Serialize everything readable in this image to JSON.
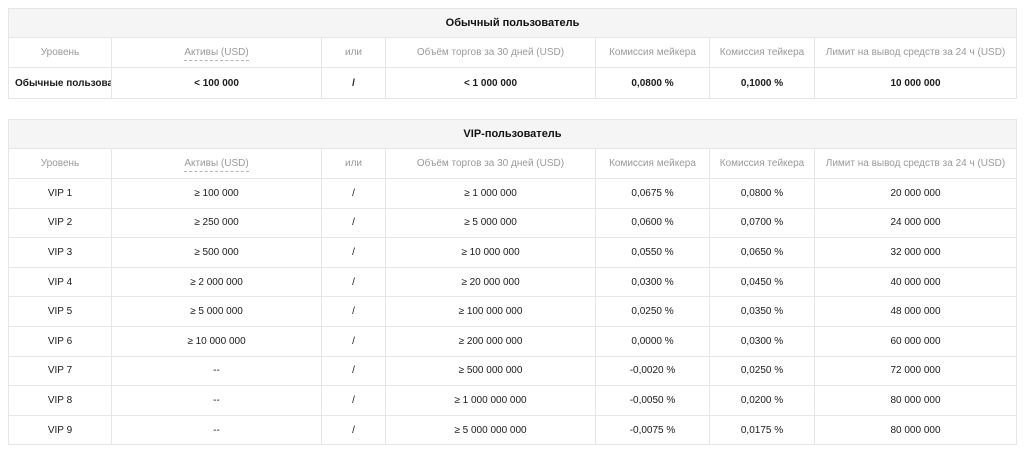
{
  "regular": {
    "title": "Обычный пользователь",
    "headers": {
      "level": "Уровень",
      "assets": "Активы (USD)",
      "or": "или",
      "volume": "Объём торгов за 30 дней (USD)",
      "maker": "Комиссия мейкера",
      "taker": "Комиссия тейкера",
      "limit": "Лимит на вывод средств за 24 ч (USD)"
    },
    "rows": [
      {
        "level": "Обычные пользователи",
        "assets": "< 100 000",
        "or": "/",
        "volume": "< 1 000 000",
        "maker": "0,0800 %",
        "taker": "0,1000 %",
        "limit": "10 000 000"
      }
    ]
  },
  "vip": {
    "title": "VIP-пользователь",
    "headers": {
      "level": "Уровень",
      "assets": "Активы (USD)",
      "or": "или",
      "volume": "Объём торгов за 30 дней (USD)",
      "maker": "Комиссия мейкера",
      "taker": "Комиссия тейкера",
      "limit": "Лимит на вывод средств за 24 ч (USD)"
    },
    "rows": [
      {
        "level": "VIP 1",
        "assets": "≥ 100 000",
        "or": "/",
        "volume": "≥ 1 000 000",
        "maker": "0,0675 %",
        "taker": "0,0800 %",
        "limit": "20 000 000"
      },
      {
        "level": "VIP 2",
        "assets": "≥ 250 000",
        "or": "/",
        "volume": "≥ 5 000 000",
        "maker": "0,0600 %",
        "taker": "0,0700 %",
        "limit": "24 000 000"
      },
      {
        "level": "VIP 3",
        "assets": "≥ 500 000",
        "or": "/",
        "volume": "≥ 10 000 000",
        "maker": "0,0550 %",
        "taker": "0,0650 %",
        "limit": "32 000 000"
      },
      {
        "level": "VIP 4",
        "assets": "≥ 2 000 000",
        "or": "/",
        "volume": "≥ 20 000 000",
        "maker": "0,0300 %",
        "taker": "0,0450 %",
        "limit": "40 000 000"
      },
      {
        "level": "VIP 5",
        "assets": "≥ 5 000 000",
        "or": "/",
        "volume": "≥ 100 000 000",
        "maker": "0,0250 %",
        "taker": "0,0350 %",
        "limit": "48 000 000"
      },
      {
        "level": "VIP 6",
        "assets": "≥ 10 000 000",
        "or": "/",
        "volume": "≥ 200 000 000",
        "maker": "0,0000 %",
        "taker": "0,0300 %",
        "limit": "60 000 000"
      },
      {
        "level": "VIP 7",
        "assets": "--",
        "or": "/",
        "volume": "≥ 500 000 000",
        "maker": "-0,0020 %",
        "taker": "0,0250 %",
        "limit": "72 000 000"
      },
      {
        "level": "VIP 8",
        "assets": "--",
        "or": "/",
        "volume": "≥ 1 000 000 000",
        "maker": "-0,0050 %",
        "taker": "0,0200 %",
        "limit": "80 000 000"
      },
      {
        "level": "VIP 9",
        "assets": "--",
        "or": "/",
        "volume": "≥ 5 000 000 000",
        "maker": "-0,0075 %",
        "taker": "0,0175 %",
        "limit": "80 000 000"
      }
    ]
  }
}
